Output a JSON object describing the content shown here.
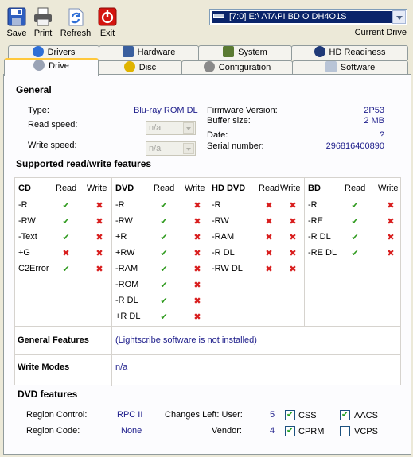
{
  "toolbar": {
    "save": "Save",
    "print": "Print",
    "refresh": "Refresh",
    "exit": "Exit"
  },
  "drive": {
    "selected": "[7:0]  E:\\ ATAPI   BD  O  DH4O1S",
    "caption": "Current Drive"
  },
  "tabs_row1": [
    "Drivers",
    "Hardware",
    "System",
    "HD Readiness"
  ],
  "tabs_row2": [
    "Drive",
    "Disc",
    "Configuration",
    "Software"
  ],
  "general": {
    "title": "General",
    "type_label": "Type:",
    "type_value": "Blu-ray ROM DL",
    "read_speed_label": "Read speed:",
    "read_speed_value": "n/a",
    "write_speed_label": "Write speed:",
    "write_speed_value": "n/a",
    "firmware_label": "Firmware Version:",
    "firmware_value": "2P53",
    "buffer_label": "Buffer size:",
    "buffer_value": "2 MB",
    "date_label": "Date:",
    "date_value": "?",
    "serial_label": "Serial number:",
    "serial_value": "296816400890"
  },
  "features": {
    "title": "Supported read/write features",
    "read_col": "Read",
    "write_col": "Write",
    "groups": [
      {
        "name": "CD",
        "rows": [
          {
            "label": "-R",
            "read": true,
            "write": false
          },
          {
            "label": "-RW",
            "read": true,
            "write": false
          },
          {
            "label": "-Text",
            "read": true,
            "write": false
          },
          {
            "label": "+G",
            "read": false,
            "write": false
          },
          {
            "label": "C2Error",
            "read": true,
            "write": false
          }
        ]
      },
      {
        "name": "DVD",
        "rows": [
          {
            "label": "-R",
            "read": true,
            "write": false
          },
          {
            "label": "-RW",
            "read": true,
            "write": false
          },
          {
            "label": "+R",
            "read": true,
            "write": false
          },
          {
            "label": "+RW",
            "read": true,
            "write": false
          },
          {
            "label": "-RAM",
            "read": true,
            "write": false
          },
          {
            "label": "-ROM",
            "read": true,
            "write": false
          },
          {
            "label": "-R DL",
            "read": true,
            "write": false
          },
          {
            "label": "+R DL",
            "read": true,
            "write": false
          }
        ]
      },
      {
        "name": "HD DVD",
        "rows": [
          {
            "label": "-R",
            "read": false,
            "write": false
          },
          {
            "label": "-RW",
            "read": false,
            "write": false
          },
          {
            "label": "-RAM",
            "read": false,
            "write": false
          },
          {
            "label": "-R DL",
            "read": false,
            "write": false
          },
          {
            "label": "-RW DL",
            "read": false,
            "write": false
          }
        ]
      },
      {
        "name": "BD",
        "rows": [
          {
            "label": "-R",
            "read": true,
            "write": false
          },
          {
            "label": "-RE",
            "read": true,
            "write": false
          },
          {
            "label": "-R DL",
            "read": true,
            "write": false
          },
          {
            "label": "-RE DL",
            "read": true,
            "write": false
          }
        ]
      }
    ],
    "general_features_label": "General Features",
    "general_features_value": "(Lightscribe software is not installed)",
    "write_modes_label": "Write Modes",
    "write_modes_value": "n/a"
  },
  "dvd_features": {
    "title": "DVD features",
    "region_control_label": "Region Control:",
    "region_control_value": "RPC II",
    "region_code_label": "Region Code:",
    "region_code_value": "None",
    "changes_left_label": "Changes Left: User:",
    "changes_left_value": "5",
    "vendor_label": "Vendor:",
    "vendor_value": "4",
    "checkboxes": [
      {
        "label": "CSS",
        "checked": true
      },
      {
        "label": "AACS",
        "checked": true
      },
      {
        "label": "CPRM",
        "checked": true
      },
      {
        "label": "VCPS",
        "checked": false
      }
    ]
  },
  "colors": {
    "check": "#2f9a1e",
    "cross": "#d81c1c",
    "value_text": "#1c1c8a",
    "active_tab_accent": "#ffc83c"
  },
  "icons": {
    "check": "check-icon",
    "cross": "cross-icon"
  }
}
